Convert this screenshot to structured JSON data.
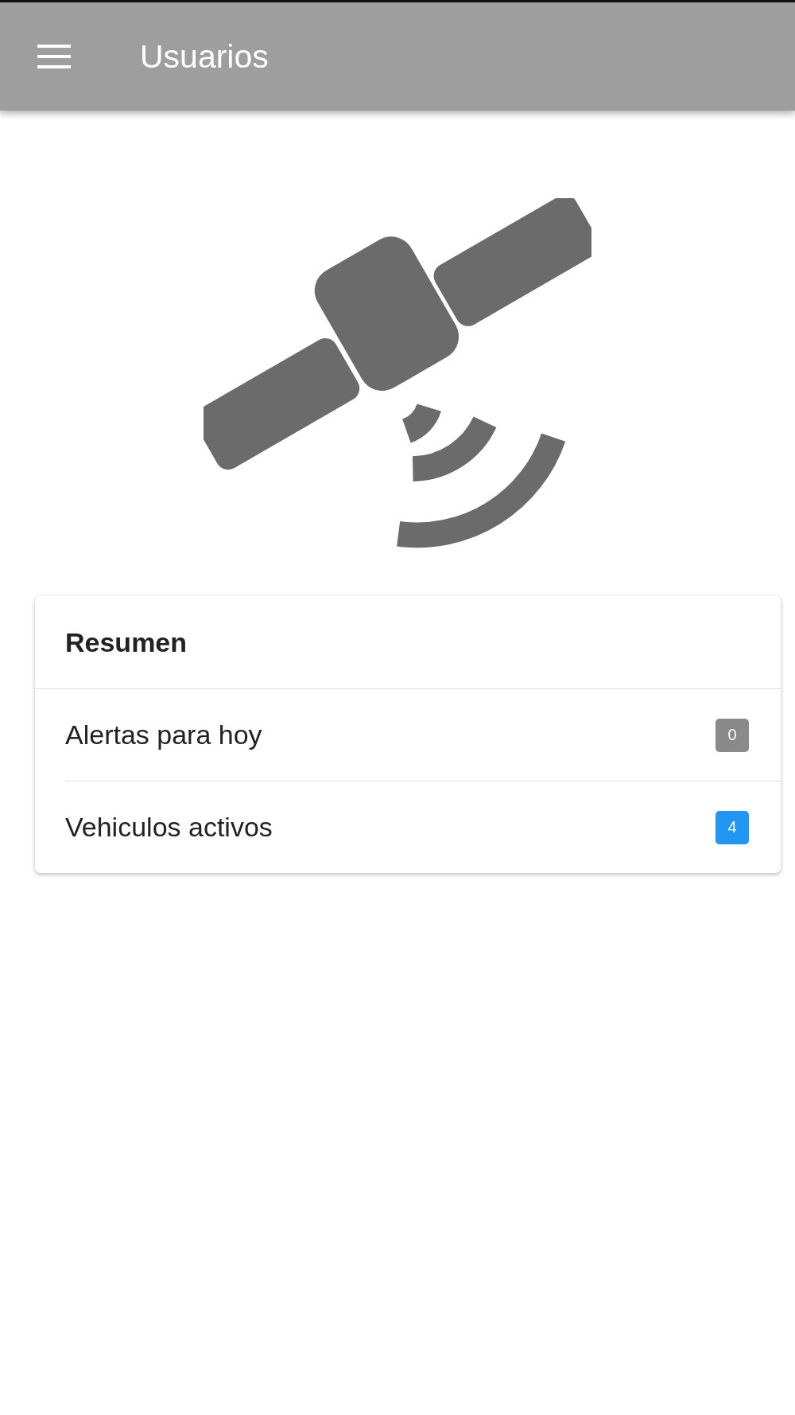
{
  "app_bar": {
    "title": "Usuarios"
  },
  "summary": {
    "title": "Resumen",
    "items": [
      {
        "label": "Alertas para hoy",
        "count": "0",
        "color": "#8a8a8a"
      },
      {
        "label": "Vehiculos activos",
        "count": "4",
        "color": "#2196f3"
      }
    ]
  }
}
